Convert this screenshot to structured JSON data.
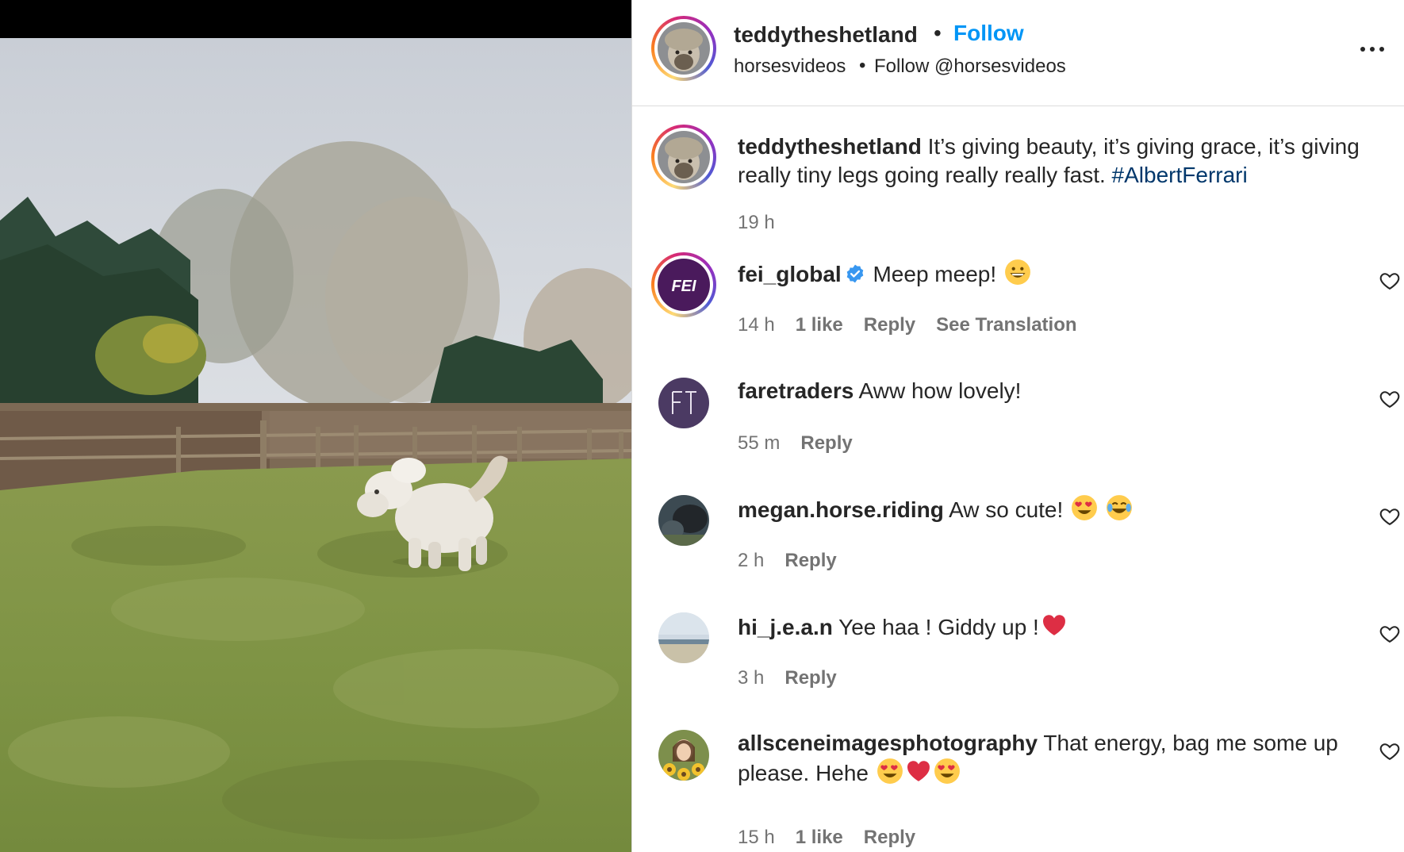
{
  "post": {
    "author": "teddytheshetland",
    "separator": "•",
    "follow_label": "Follow",
    "collab_account": "horsesvideos",
    "collab_follow_label": "Follow @horsesvideos",
    "more_icon": "more-horizontal-icon"
  },
  "caption": {
    "username": "teddytheshetland",
    "text": "It’s giving beauty, it’s giving grace, it’s giving really tiny legs going really really fast. ",
    "hashtag": "#AlbertFerrari",
    "time": "19 h"
  },
  "comments": [
    {
      "username": "fei_global",
      "verified": true,
      "text": "Meep meep!",
      "emojis": [
        "grinning-face"
      ],
      "time": "14 h",
      "likes": "1 like",
      "reply": "Reply",
      "translation": "See Translation"
    },
    {
      "username": "faretraders",
      "verified": false,
      "text": "Aww how lovely!",
      "emojis": [],
      "time": "55 m",
      "likes": "",
      "reply": "Reply",
      "translation": ""
    },
    {
      "username": "megan.horse.riding",
      "verified": false,
      "text": "Aw so cute!",
      "emojis": [
        "heart-eyes",
        "tears-of-joy"
      ],
      "time": "2 h",
      "likes": "",
      "reply": "Reply",
      "translation": ""
    },
    {
      "username": "hi_j.e.a.n",
      "verified": false,
      "text": "Yee haa ! Giddy up !",
      "emojis": [
        "red-heart"
      ],
      "time": "3 h",
      "likes": "",
      "reply": "Reply",
      "translation": ""
    },
    {
      "username": "allsceneimagesphotography",
      "verified": false,
      "text": "That energy, bag me some up please. Hehe",
      "emojis": [
        "heart-eyes",
        "red-heart",
        "heart-eyes"
      ],
      "time": "15 h",
      "likes": "1 like",
      "reply": "Reply",
      "translation": ""
    }
  ],
  "colors": {
    "link_blue": "#0095f6",
    "hashtag": "#00376b",
    "secondary_text": "#737373",
    "fei_purple": "#4a1a5c",
    "faretraders_purple": "#4b3a63"
  }
}
